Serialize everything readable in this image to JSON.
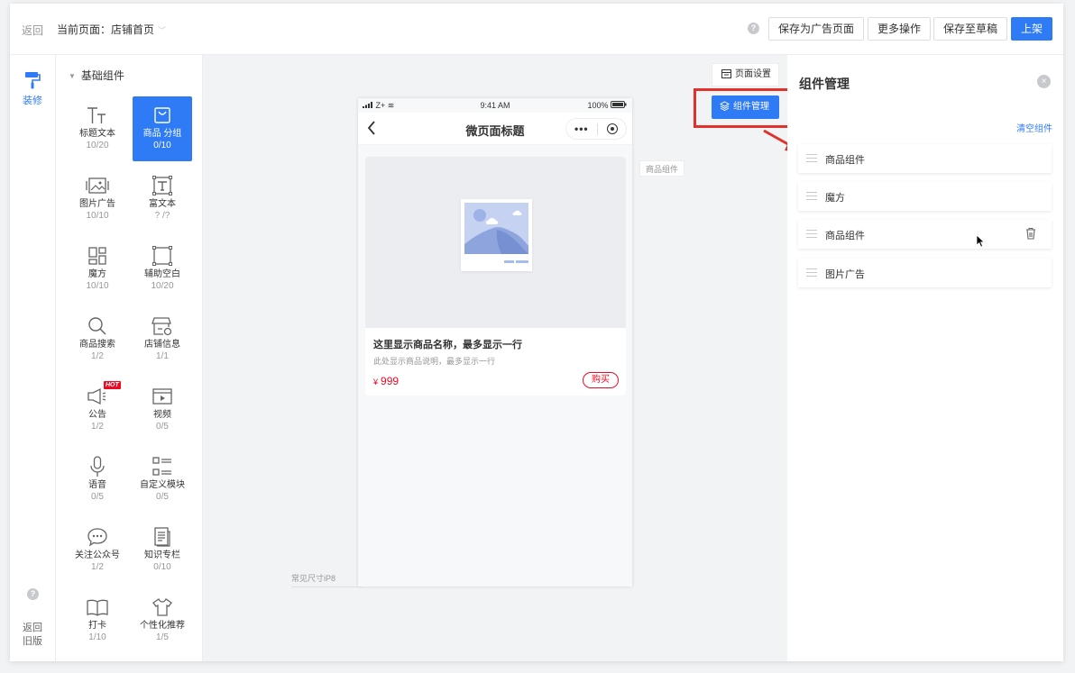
{
  "topbar": {
    "back": "返回",
    "current_page_label": "当前页面：店铺首页",
    "help": "?",
    "buttons": {
      "save_ad": "保存为广告页面",
      "more": "更多操作",
      "save_draft": "保存至草稿",
      "publish": "上架"
    }
  },
  "rail": {
    "decorate": "装修",
    "help": "?",
    "old_line1": "返回",
    "old_line2": "旧版"
  },
  "palette": {
    "title": "基础组件",
    "items": [
      {
        "name": "标题文本",
        "count": "10/20",
        "icon": "title-text-icon"
      },
      {
        "name": "商品 分组",
        "count": "0/10",
        "icon": "goods-bag-icon",
        "active": true
      },
      {
        "name": "图片广告",
        "count": "10/10",
        "icon": "image-ad-icon"
      },
      {
        "name": "富文本",
        "count": "? /?",
        "icon": "rich-text-icon"
      },
      {
        "name": "魔方",
        "count": "10/10",
        "icon": "cube-icon"
      },
      {
        "name": "辅助空白",
        "count": "10/20",
        "icon": "blank-space-icon"
      },
      {
        "name": "商品搜索",
        "count": "1/2",
        "icon": "search-icon"
      },
      {
        "name": "店铺信息",
        "count": "1/1",
        "icon": "store-icon"
      },
      {
        "name": "公告",
        "count": "1/2",
        "icon": "megaphone-icon",
        "badge": "HOT"
      },
      {
        "name": "视频",
        "count": "0/5",
        "icon": "video-icon"
      },
      {
        "name": "语音",
        "count": "0/5",
        "icon": "microphone-icon"
      },
      {
        "name": "自定义模块",
        "count": "0/5",
        "icon": "custom-module-icon"
      },
      {
        "name": "关注公众号",
        "count": "1/2",
        "icon": "chat-bubble-icon"
      },
      {
        "name": "知识专栏",
        "count": "0/10",
        "icon": "document-icon"
      },
      {
        "name": "打卡",
        "count": "1/10",
        "icon": "book-icon"
      },
      {
        "name": "个性化推荐",
        "count": "1/5",
        "icon": "tshirt-icon"
      }
    ]
  },
  "phone": {
    "signal": "Z+",
    "time": "9:41 AM",
    "battery": "100%",
    "title": "微页面标题",
    "capsule_dots": "•••",
    "goods": {
      "name": "这里显示商品名称，最多显示一行",
      "desc": "此处显示商品说明，最多显示一行",
      "currency": "¥",
      "price": "999",
      "buy": "购买"
    }
  },
  "canvas": {
    "side_tag": "商品组件",
    "size_label": "常见尺寸iP8",
    "page_settings": "页面设置",
    "component_manage": "组件管理"
  },
  "panel": {
    "title": "组件管理",
    "close": "×",
    "clear": "清空组件",
    "items": [
      "商品组件",
      "魔方",
      "商品组件",
      "图片广告"
    ]
  },
  "colors": {
    "accent": "#2f7bf5",
    "highlight_box": "#e0312b",
    "price": "#ee0a24"
  }
}
